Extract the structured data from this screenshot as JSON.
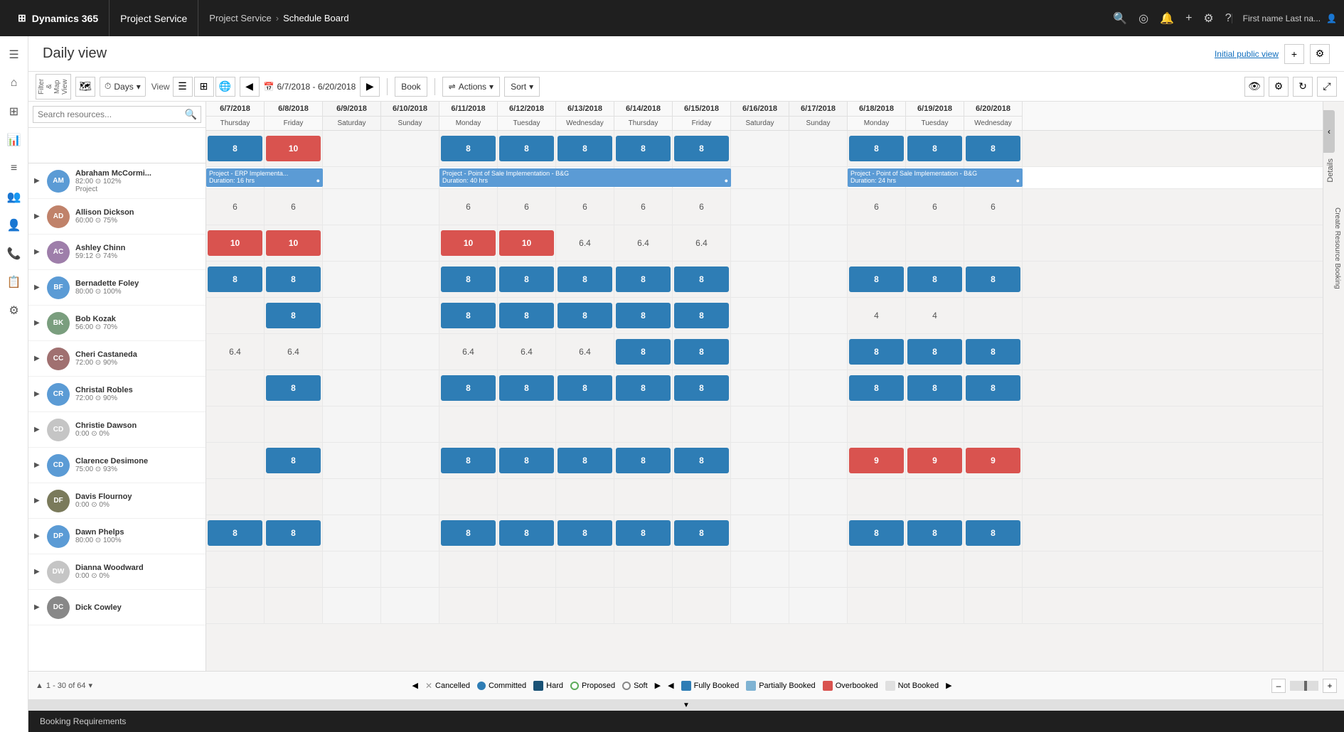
{
  "app": {
    "brand": "Dynamics 365",
    "app_name": "Project Service",
    "breadcrumb": [
      "Project Service",
      "Schedule Board"
    ]
  },
  "header": {
    "title": "Daily view",
    "initial_public_view": "Initial public view"
  },
  "toolbar": {
    "filter_map_view": "Filter & Map View",
    "view_mode": "Days",
    "view_label": "View",
    "date_range": "6/7/2018 - 6/20/2018",
    "book_label": "Book",
    "actions_label": "Actions",
    "sort_label": "Sort"
  },
  "search": {
    "placeholder": "Search resources..."
  },
  "dates": [
    {
      "date": "6/7/2018",
      "day": "Thursday"
    },
    {
      "date": "6/8/2018",
      "day": "Friday"
    },
    {
      "date": "6/9/2018",
      "day": "Saturday"
    },
    {
      "date": "6/10/2018",
      "day": "Sunday"
    },
    {
      "date": "6/11/2018",
      "day": "Monday"
    },
    {
      "date": "6/12/2018",
      "day": "Tuesday"
    },
    {
      "date": "6/13/2018",
      "day": "Wednesday"
    },
    {
      "date": "6/14/2018",
      "day": "Thursday"
    },
    {
      "date": "6/15/2018",
      "day": "Friday"
    },
    {
      "date": "6/16/2018",
      "day": "Saturday"
    },
    {
      "date": "6/17/2018",
      "day": "Sunday"
    },
    {
      "date": "6/18/2018",
      "day": "Monday"
    },
    {
      "date": "6/19/2018",
      "day": "Tuesday"
    },
    {
      "date": "6/20/2018",
      "day": "Wednesday"
    }
  ],
  "resources": [
    {
      "name": "Abraham McCormi...",
      "meta": "82:00 ⊙  102%",
      "sub": "Project",
      "initials": "AM",
      "color": "#5b9bd5",
      "cells": [
        "8",
        "10",
        "",
        "",
        "8",
        "8",
        "8",
        "8",
        "8",
        "",
        "",
        "8",
        "8",
        "8"
      ],
      "cell_types": [
        "blue",
        "red",
        "",
        "",
        "blue",
        "blue",
        "blue",
        "blue",
        "blue",
        "",
        "",
        "blue",
        "blue",
        "blue"
      ],
      "projects": [
        {
          "label": "Project - ERP Implementa...\nDuration: 16 hrs",
          "start": 0,
          "span": 2
        },
        {
          "label": "Project - Point of Sale Implementation - B&G\nDuration: 40 hrs",
          "start": 4,
          "span": 5
        },
        {
          "label": "Project - Point of Sale Implementation - B&G\nDuration: 24 hrs",
          "start": 11,
          "span": 3
        }
      ]
    },
    {
      "name": "Allison Dickson",
      "meta": "60:00 ⊙  75%",
      "initials": "AD",
      "color": "#c5c5c5",
      "cells": [
        "6",
        "6",
        "",
        "",
        "6",
        "6",
        "6",
        "6",
        "6",
        "",
        "",
        "6",
        "6",
        "6"
      ],
      "cell_types": [
        "plain",
        "plain",
        "",
        "",
        "plain",
        "plain",
        "plain",
        "plain",
        "plain",
        "",
        "",
        "plain",
        "plain",
        "plain"
      ]
    },
    {
      "name": "Ashley Chinn",
      "meta": "59:12 ⊙  74%",
      "initials": "AC",
      "color": "#c5c5c5",
      "cells": [
        "10",
        "10",
        "",
        "",
        "10",
        "10",
        "6.4",
        "6.4",
        "6.4",
        "",
        "",
        "",
        "",
        ""
      ],
      "cell_types": [
        "red",
        "red",
        "",
        "",
        "red",
        "red",
        "plain",
        "plain",
        "plain",
        "",
        "",
        "",
        "",
        ""
      ]
    },
    {
      "name": "Bernadette Foley",
      "meta": "80:00 ⊙  100%",
      "initials": "BF",
      "color": "#c5c5c5",
      "cells": [
        "8",
        "8",
        "",
        "",
        "8",
        "8",
        "8",
        "8",
        "8",
        "",
        "",
        "8",
        "8",
        "8"
      ],
      "cell_types": [
        "blue",
        "blue",
        "",
        "",
        "blue",
        "blue",
        "blue",
        "blue",
        "blue",
        "",
        "",
        "blue",
        "blue",
        "blue"
      ]
    },
    {
      "name": "Bob Kozak",
      "meta": "56:00 ⊙  70%",
      "initials": "BK",
      "color": "#c5c5c5",
      "cells": [
        "",
        "8",
        "",
        "",
        "8",
        "8",
        "8",
        "8",
        "8",
        "",
        "",
        "4",
        "4",
        ""
      ],
      "cell_types": [
        "",
        "blue",
        "",
        "",
        "blue",
        "blue",
        "blue",
        "blue",
        "blue",
        "",
        "",
        "plain",
        "plain",
        ""
      ]
    },
    {
      "name": "Cheri Castaneda",
      "meta": "72:00 ⊙  90%",
      "initials": "CC",
      "color": "#c5c5c5",
      "cells": [
        "6.4",
        "6.4",
        "",
        "",
        "6.4",
        "6.4",
        "6.4",
        "8",
        "8",
        "",
        "",
        "8",
        "8",
        "8"
      ],
      "cell_types": [
        "plain",
        "plain",
        "",
        "",
        "plain",
        "plain",
        "plain",
        "blue",
        "blue",
        "",
        "",
        "blue",
        "blue",
        "blue"
      ]
    },
    {
      "name": "Christal Robles",
      "meta": "72:00 ⊙  90%",
      "initials": "CR",
      "color": "#c5c5c5",
      "cells": [
        "",
        "8",
        "",
        "",
        "8",
        "8",
        "8",
        "8",
        "8",
        "",
        "",
        "8",
        "8",
        "8"
      ],
      "cell_types": [
        "",
        "blue",
        "",
        "",
        "blue",
        "blue",
        "blue",
        "blue",
        "blue",
        "",
        "",
        "blue",
        "blue",
        "blue"
      ]
    },
    {
      "name": "Christie Dawson",
      "meta": "0:00 ⊙  0%",
      "initials": "CD",
      "color": "#c5c5c5",
      "cells": [
        "",
        "",
        "",
        "",
        "",
        "",
        "",
        "",
        "",
        "",
        "",
        "",
        "",
        ""
      ],
      "cell_types": [
        "",
        "",
        "",
        "",
        "",
        "",
        "",
        "",
        "",
        "",
        "",
        "",
        "",
        ""
      ]
    },
    {
      "name": "Clarence Desimone",
      "meta": "75:00 ⊙  93%",
      "initials": "CD",
      "color": "#c5c5c5",
      "cells": [
        "",
        "8",
        "",
        "",
        "8",
        "8",
        "8",
        "8",
        "8",
        "",
        "",
        "9",
        "9",
        "9"
      ],
      "cell_types": [
        "",
        "blue",
        "",
        "",
        "blue",
        "blue",
        "blue",
        "blue",
        "blue",
        "",
        "",
        "red",
        "red",
        "red"
      ]
    },
    {
      "name": "Davis Flournoy",
      "meta": "0:00 ⊙  0%",
      "initials": "DF",
      "color": "#c5c5c5",
      "cells": [
        "",
        "",
        "",
        "",
        "",
        "",
        "",
        "",
        "",
        "",
        "",
        "",
        "",
        ""
      ],
      "cell_types": [
        "",
        "",
        "",
        "",
        "",
        "",
        "",
        "",
        "",
        "",
        "",
        "",
        "",
        ""
      ]
    },
    {
      "name": "Dawn Phelps",
      "meta": "80:00 ⊙  100%",
      "initials": "DP",
      "color": "#c5c5c5",
      "cells": [
        "8",
        "8",
        "",
        "",
        "8",
        "8",
        "8",
        "8",
        "8",
        "",
        "",
        "8",
        "8",
        "8"
      ],
      "cell_types": [
        "blue",
        "blue",
        "",
        "",
        "blue",
        "blue",
        "blue",
        "blue",
        "blue",
        "",
        "",
        "blue",
        "blue",
        "blue"
      ]
    },
    {
      "name": "Dianna Woodward",
      "meta": "0:00 ⊙  0%",
      "initials": "DW",
      "color": "#c5c5c5",
      "cells": [
        "",
        "",
        "",
        "",
        "",
        "",
        "",
        "",
        "",
        "",
        "",
        "",
        "",
        ""
      ],
      "cell_types": [
        "",
        "",
        "",
        "",
        "",
        "",
        "",
        "",
        "",
        "",
        "",
        "",
        "",
        ""
      ]
    },
    {
      "name": "Dick Cowley",
      "meta": "",
      "initials": "DC",
      "color": "#c5c5c5",
      "cells": [
        "",
        "",
        "",
        "",
        "",
        "",
        "",
        "",
        "",
        "",
        "",
        "",
        "",
        ""
      ],
      "cell_types": [
        "",
        "",
        "",
        "",
        "",
        "",
        "",
        "",
        "",
        "",
        "",
        "",
        "",
        ""
      ]
    }
  ],
  "legend": {
    "cancelled": "Cancelled",
    "committed": "Committed",
    "hard": "Hard",
    "proposed": "Proposed",
    "soft": "Soft",
    "fully_booked": "Fully Booked",
    "partially_booked": "Partially Booked",
    "overbooked": "Overbooked",
    "not_booked": "Not Booked"
  },
  "pagination": {
    "text": "1 - 30 of 64"
  },
  "footer": {
    "booking_requirements": "Booking Requirements"
  },
  "user": {
    "display": "First name Last na..."
  },
  "right_panel": {
    "details": "Details",
    "create_resource_booking": "Create Resource Booking"
  }
}
